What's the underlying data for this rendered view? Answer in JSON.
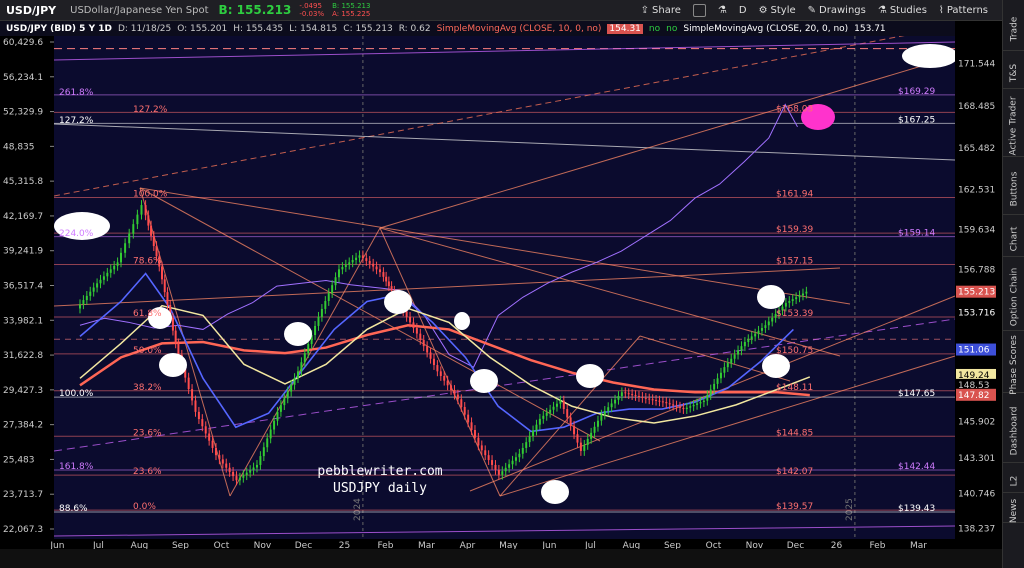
{
  "header": {
    "symbol": "USD/JPY",
    "description": "USDollar/Japanese Yen Spot",
    "bid": "B: 155.213",
    "change": "-.0495",
    "change_pct": "-0.03%",
    "mini_bid": "B: 155.213",
    "mini_ask": "A: 155.225",
    "buttons": [
      "Share",
      "D",
      "Style",
      "Drawings",
      "Studies",
      "Patterns"
    ]
  },
  "info": {
    "title": "USD/JPY (BID) 5 Y 1D",
    "date": "D: 11/18/25",
    "open": "O: 155.201",
    "high": "H: 155.435",
    "low": "L: 154.815",
    "close": "C: 155.213",
    "range": "R: 0.62",
    "sma10": "SimpleMovingAvg (CLOSE, 10, 0, no)",
    "sma10_val": "154.31",
    "sma20": "SimpleMovingAvg (CLOSE, 20, 0, no)",
    "sma20_val": "153.71"
  },
  "sidebar": [
    "Trade",
    "T&S",
    "Active Trader",
    "Buttons",
    "Chart",
    "Option Chain",
    "Phase Scores",
    "Dashboard",
    "L2",
    "News"
  ],
  "chart_data": {
    "type": "line",
    "title": "USDJPY daily",
    "watermark": "pebblewriter.com",
    "x_labels": [
      "Jun",
      "Jul",
      "Aug",
      "Sep",
      "Oct",
      "Nov",
      "Dec",
      "25",
      "Feb",
      "Mar",
      "Apr",
      "May",
      "Jun",
      "Jul",
      "Aug",
      "Sep",
      "Oct",
      "Nov",
      "Dec",
      "26",
      "Feb",
      "Mar"
    ],
    "year_markers": [
      "2024",
      "2025"
    ],
    "right_ticks": [
      "171.544",
      "168.485",
      "165.482",
      "162.531",
      "159.634",
      "156.788",
      "153.716",
      "151.06",
      "149.24",
      "148.53",
      "147.82",
      "145.902",
      "143.301",
      "140.746",
      "138.237"
    ],
    "left_ticks": [
      "60,429.6",
      "56,234.1",
      "52,329.9",
      "48,835",
      "45,315.8",
      "42,169.7",
      "39,241.9",
      "36,517.4",
      "33,982.1",
      "31,622.8",
      "29,427.3",
      "27,384.2",
      "25,483",
      "23,713.7",
      "22,067.3"
    ],
    "ylim": [
      137.5,
      173.5
    ],
    "level_labels": [
      {
        "text": "$168.03",
        "y": 168.03,
        "color": "#ff7070"
      },
      {
        "text": "$169.29",
        "y": 169.29,
        "color": "#d07cff"
      },
      {
        "text": "$167.25",
        "y": 167.25,
        "color": "#ffffff"
      },
      {
        "text": "$161.94",
        "y": 161.94,
        "color": "#ff7070"
      },
      {
        "text": "$159.39",
        "y": 159.39,
        "color": "#ff7070"
      },
      {
        "text": "$159.14",
        "y": 159.14,
        "color": "#d07cff"
      },
      {
        "text": "$157.15",
        "y": 157.15,
        "color": "#ff7070"
      },
      {
        "text": "$153.39",
        "y": 153.39,
        "color": "#ff7070"
      },
      {
        "text": "$150.75",
        "y": 150.75,
        "color": "#ff7070"
      },
      {
        "text": "$148.11",
        "y": 148.11,
        "color": "#ff7070"
      },
      {
        "text": "$147.65",
        "y": 147.65,
        "color": "#ffffff"
      },
      {
        "text": "$144.85",
        "y": 144.85,
        "color": "#ff7070"
      },
      {
        "text": "$142.44",
        "y": 142.44,
        "color": "#d07cff"
      },
      {
        "text": "$142.07",
        "y": 142.07,
        "color": "#ff7070"
      },
      {
        "text": "$139.57",
        "y": 139.57,
        "color": "#ff7070"
      },
      {
        "text": "$139.43",
        "y": 139.43,
        "color": "#ffffff"
      }
    ],
    "fib_labels": [
      {
        "text": "261.8%",
        "y": 169.2,
        "color": "#d07cff"
      },
      {
        "text": "127.2%",
        "y": 168.0,
        "color": "#ff7070"
      },
      {
        "text": "127.2%",
        "y": 167.2,
        "color": "#ffffff"
      },
      {
        "text": "100.0%",
        "y": 161.94,
        "color": "#ff7070"
      },
      {
        "text": "224.0%",
        "y": 159.1,
        "color": "#d07cff"
      },
      {
        "text": "78.6%",
        "y": 157.15,
        "color": "#ff7070"
      },
      {
        "text": "61.8%",
        "y": 153.39,
        "color": "#ff7070"
      },
      {
        "text": "50.0%",
        "y": 150.75,
        "color": "#ff7070"
      },
      {
        "text": "38.2%",
        "y": 148.11,
        "color": "#ff7070"
      },
      {
        "text": "100.0%",
        "y": 147.65,
        "color": "#ffffff"
      },
      {
        "text": "23.6%",
        "y": 144.85,
        "color": "#ff7070"
      },
      {
        "text": "161.8%",
        "y": 142.44,
        "color": "#d07cff"
      },
      {
        "text": "23.6%",
        "y": 142.07,
        "color": "#ff7070"
      },
      {
        "text": "88.6%",
        "y": 139.43,
        "color": "#ffffff"
      },
      {
        "text": "0.0%",
        "y": 139.57,
        "color": "#ff7070"
      }
    ],
    "right_badges": [
      {
        "text": "155.213",
        "y": 155.2,
        "bg": "#d9534f",
        "fg": "#fff"
      },
      {
        "text": "153.716",
        "y": 153.72,
        "bg": "#000",
        "fg": "#fff"
      },
      {
        "text": "151.06",
        "y": 151.06,
        "bg": "#3d4fd8",
        "fg": "#fff"
      },
      {
        "text": "149.24",
        "y": 149.24,
        "bg": "#f2e7a0",
        "fg": "#000"
      },
      {
        "text": "148.53",
        "y": 148.53,
        "bg": "#000",
        "fg": "#ccc"
      },
      {
        "text": "147.82",
        "y": 147.82,
        "bg": "#d9534f",
        "fg": "#fff"
      }
    ],
    "price": {
      "x": [
        0,
        0.5,
        1,
        1.6,
        2,
        2.4,
        2.9,
        3.4,
        3.9,
        4.4,
        4.9,
        5.4,
        5.9,
        6.4,
        6.9,
        7.4,
        7.8,
        8.3,
        8.8,
        9.3,
        9.8,
        10.3,
        10.8,
        11.3,
        11.8,
        12.3,
        12.8,
        13.3,
        13.8,
        14.3,
        14.8,
        15.3,
        15.8,
        16.3,
        16.8,
        17.3,
        17.8
      ],
      "y": [
        154,
        155.8,
        157.3,
        161.4,
        157,
        151.5,
        146.6,
        143.5,
        141.7,
        142.8,
        146.6,
        149.5,
        153.4,
        156.8,
        157.8,
        156.6,
        154.6,
        152.2,
        149.5,
        147.5,
        144.2,
        142.1,
        143.6,
        146.1,
        147.4,
        143.8,
        146.4,
        148,
        147.6,
        147.3,
        146.8,
        147.4,
        149.8,
        151.6,
        152.8,
        154.4,
        155.2
      ]
    },
    "ratio": {
      "x": [
        0,
        0.6,
        1.2,
        1.8,
        2.4,
        3,
        3.6,
        4.2,
        4.8,
        5.4,
        6,
        6.6,
        7.2,
        7.8,
        8.4,
        9,
        9.6,
        10.2,
        10.8,
        11.4,
        12,
        12.6,
        13.2,
        13.8,
        14.4,
        15,
        15.6,
        16.2,
        16.8,
        17.2,
        17.5
      ],
      "y": [
        152.8,
        153.3,
        153,
        152.6,
        152.8,
        152.5,
        153.6,
        154.4,
        155.6,
        155.8,
        156,
        155.7,
        155.5,
        155.3,
        153.5,
        150.7,
        149.8,
        153.5,
        154.8,
        155.8,
        156.6,
        157.3,
        158.1,
        159.2,
        160.3,
        161.9,
        162.9,
        164.5,
        166.2,
        168.6,
        167
      ]
    },
    "sma_blue": {
      "x": [
        0,
        1,
        1.6,
        2.2,
        3,
        3.8,
        4.6,
        5.4,
        6.2,
        7,
        7.8,
        8.6,
        9.4,
        10.2,
        11,
        11.8,
        12.6,
        13.4,
        14.2,
        15,
        15.8,
        16.6,
        17.4
      ],
      "y": [
        152,
        154.5,
        156.5,
        154,
        149,
        145.5,
        146.5,
        149.5,
        152.5,
        154.5,
        155,
        153,
        150.5,
        147,
        145.2,
        145.5,
        146.5,
        146.8,
        146.8,
        147.3,
        148.3,
        150.2,
        152.5
      ]
    },
    "sma_yellow": {
      "x": [
        0,
        1,
        2,
        3,
        4,
        5,
        6,
        7,
        8,
        9,
        10,
        11,
        12,
        13,
        14,
        15,
        16,
        17,
        17.8
      ],
      "y": [
        149,
        151.5,
        154.2,
        153.5,
        150,
        148.6,
        150,
        152.5,
        154,
        153,
        150.5,
        148.5,
        147,
        146.2,
        145.8,
        146.3,
        147.1,
        148.2,
        149.1
      ]
    },
    "sma_red": {
      "x": [
        0,
        1,
        2,
        3,
        4,
        5,
        6,
        7,
        8,
        9,
        10,
        11,
        12,
        13,
        14,
        15,
        16,
        17,
        17.8
      ],
      "y": [
        148.5,
        150.5,
        151.5,
        151.6,
        151,
        150.8,
        151.2,
        152.1,
        152.8,
        152.5,
        151.4,
        150.3,
        149.4,
        148.7,
        148.2,
        148,
        148,
        148,
        147.8
      ]
    }
  }
}
